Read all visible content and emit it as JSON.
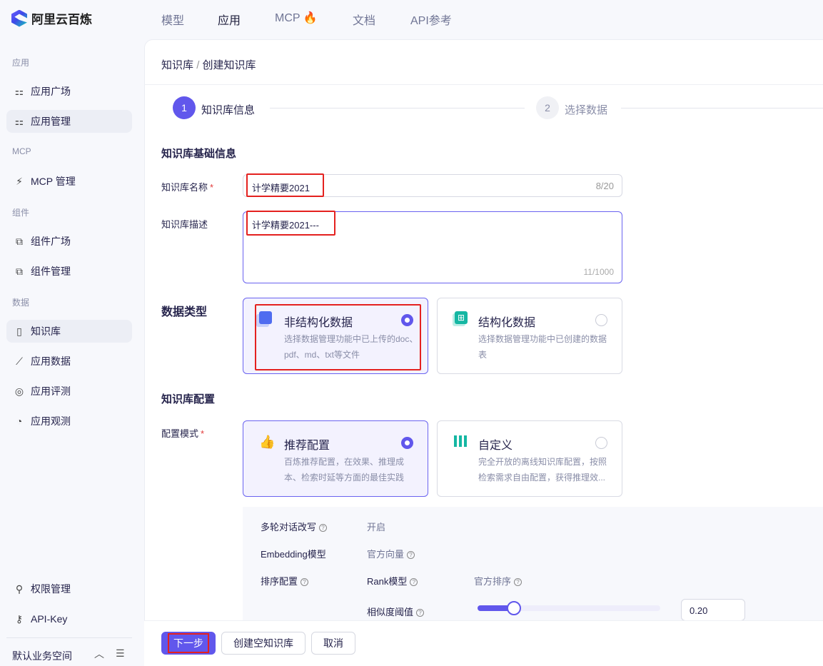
{
  "brand": {
    "name": "阿里云百炼"
  },
  "topnav": [
    {
      "label": "模型"
    },
    {
      "label": "应用"
    },
    {
      "label": "MCP"
    },
    {
      "label": "文档"
    },
    {
      "label": "API参考"
    }
  ],
  "sidebar": {
    "groups": [
      "应用",
      "MCP",
      "组件",
      "数据"
    ],
    "items": [
      {
        "label": "应用广场"
      },
      {
        "label": "应用管理"
      },
      {
        "label": "MCP 管理"
      },
      {
        "label": "组件广场"
      },
      {
        "label": "组件管理"
      },
      {
        "label": "知识库"
      },
      {
        "label": "应用数据"
      },
      {
        "label": "应用评测"
      },
      {
        "label": "应用观测"
      },
      {
        "label": "权限管理"
      },
      {
        "label": "API-Key"
      }
    ],
    "workspace": "默认业务空间"
  },
  "breadcrumb": {
    "parent": "知识库",
    "sep": "/",
    "current": "创建知识库"
  },
  "steps": [
    {
      "num": "1",
      "label": "知识库信息"
    },
    {
      "num": "2",
      "label": "选择数据"
    }
  ],
  "form": {
    "basic_title": "知识库基础信息",
    "name_label": "知识库名称",
    "required": "*",
    "name_value": "计学精要2021",
    "name_count": "8/20",
    "desc_label": "知识库描述",
    "desc_value": "计学精要2021---",
    "desc_count": "11/1000",
    "type_label": "数据类型",
    "types": [
      {
        "title": "非结构化数据",
        "desc": "选择数据管理功能中已上传的doc、pdf、md、txt等文件",
        "selected": true
      },
      {
        "title": "结构化数据",
        "desc": "选择数据管理功能中已创建的数据表",
        "selected": false
      }
    ],
    "config_title": "知识库配置",
    "mode_label": "配置模式",
    "modes": [
      {
        "title": "推荐配置",
        "desc": "百炼推荐配置，在效果、推理成本、检索时延等方面的最佳实践",
        "selected": true
      },
      {
        "title": "自定义",
        "desc": "完全开放的离线知识库配置，按照检索需求自由配置，获得推理效...",
        "selected": false
      }
    ],
    "details": {
      "rewrite_label": "多轮对话改写",
      "rewrite_value": "开启",
      "embed_label": "Embedding模型",
      "embed_value": "官方向量",
      "rank_cfg_label": "排序配置",
      "rank_model_label": "Rank模型",
      "rank_model_value": "官方排序",
      "sim_label": "相似度阈值",
      "sim_value": "0.20",
      "sim_fraction": 0.2
    }
  },
  "footer": {
    "next": "下一步",
    "create_empty": "创建空知识库",
    "cancel": "取消"
  },
  "colors": {
    "accent": "#6157ec",
    "highlight": "#e4211f"
  }
}
